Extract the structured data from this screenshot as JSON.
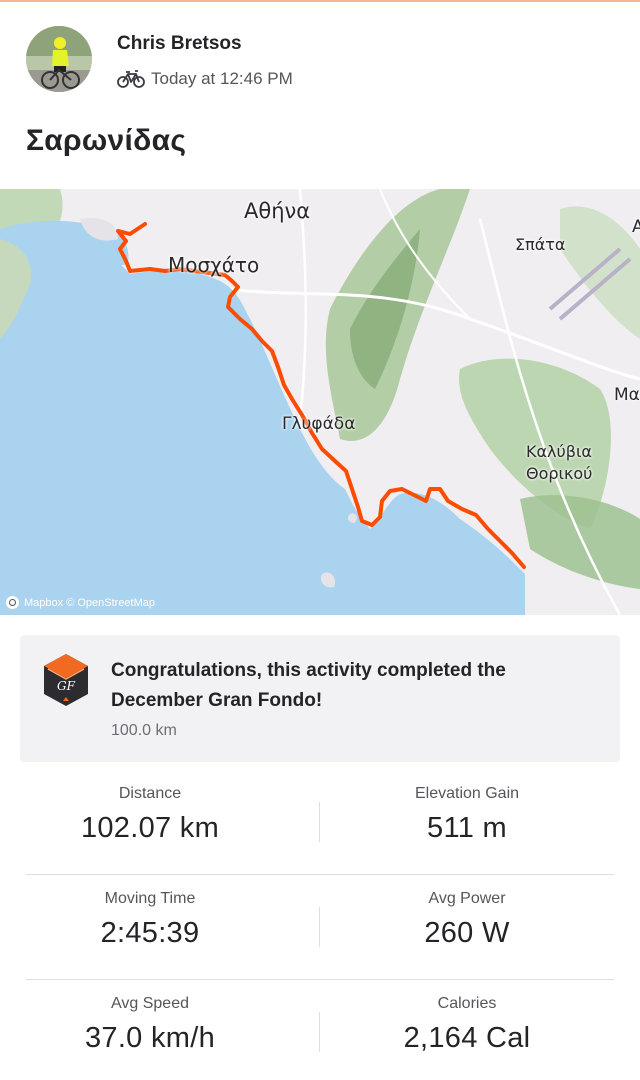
{
  "athlete": {
    "name": "Chris Bretsos",
    "activity_type_icon": "bike-icon",
    "timestamp": "Today at 12:46 PM"
  },
  "activity": {
    "title": "Σαρωνίδας"
  },
  "map": {
    "labels": {
      "athina": "Αθήνα",
      "moschato": "Μοσχάτο",
      "spata": "Σπάτα",
      "glyfada": "Γλυφάδα",
      "kalyvia_line1": "Καλύβια",
      "kalyvia_line2": "Θορικού",
      "edge_a": "Α",
      "edge_m": "Μα"
    },
    "attribution": "Mapbox © OpenStreetMap",
    "route_color": "#fc4c02",
    "sea_color": "#a9d3ee"
  },
  "achievement": {
    "text": "Congratulations, this activity completed the December Gran Fondo!",
    "subtext": "100.0 km",
    "badge_icon": "gran-fondo-badge-icon",
    "badge_letter": "GF"
  },
  "stats": [
    [
      {
        "label": "Distance",
        "value": "102.07 km"
      },
      {
        "label": "Elevation Gain",
        "value": "511 m"
      }
    ],
    [
      {
        "label": "Moving Time",
        "value": "2:45:39"
      },
      {
        "label": "Avg Power",
        "value": "260 W"
      }
    ],
    [
      {
        "label": "Avg Speed",
        "value": "37.0 km/h"
      },
      {
        "label": "Calories",
        "value": "2,164 Cal"
      }
    ]
  ]
}
